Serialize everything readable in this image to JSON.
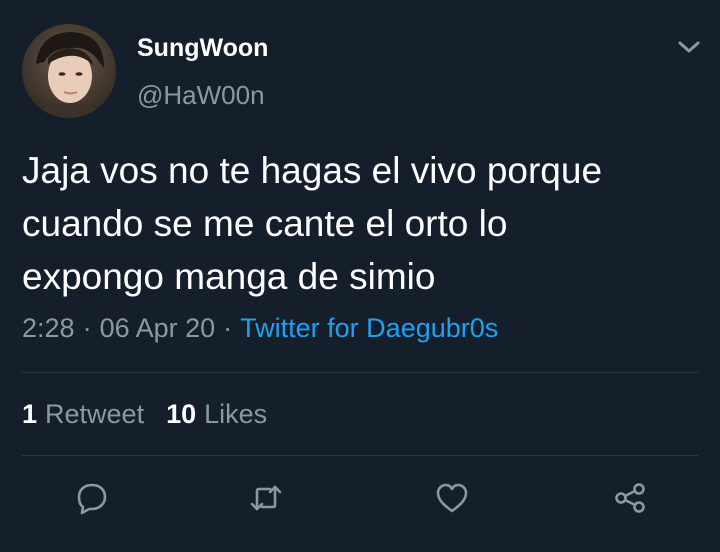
{
  "tweet": {
    "display_name": "SungWoon",
    "handle": "@HaW00n",
    "text_lines": [
      "Jaja vos no te hagas el vivo porque",
      "cuando se me cante el orto lo",
      "expongo manga de simio"
    ],
    "time": "2:28",
    "date": "06 Apr 20",
    "separator": "·",
    "source": "Twitter for Daegubr0s",
    "retweets_count": "1",
    "retweets_label": "Retweet",
    "likes_count": "10",
    "likes_label": "Likes"
  },
  "icons": {
    "menu": "chevron-down-icon",
    "reply": "reply-icon",
    "retweet": "retweet-icon",
    "like": "heart-icon",
    "share": "share-icon"
  },
  "colors": {
    "background": "#151f2b",
    "text_primary": "#ffffff",
    "text_secondary": "#8899a6",
    "link": "#1da1f2",
    "divider": "#2a3744"
  }
}
